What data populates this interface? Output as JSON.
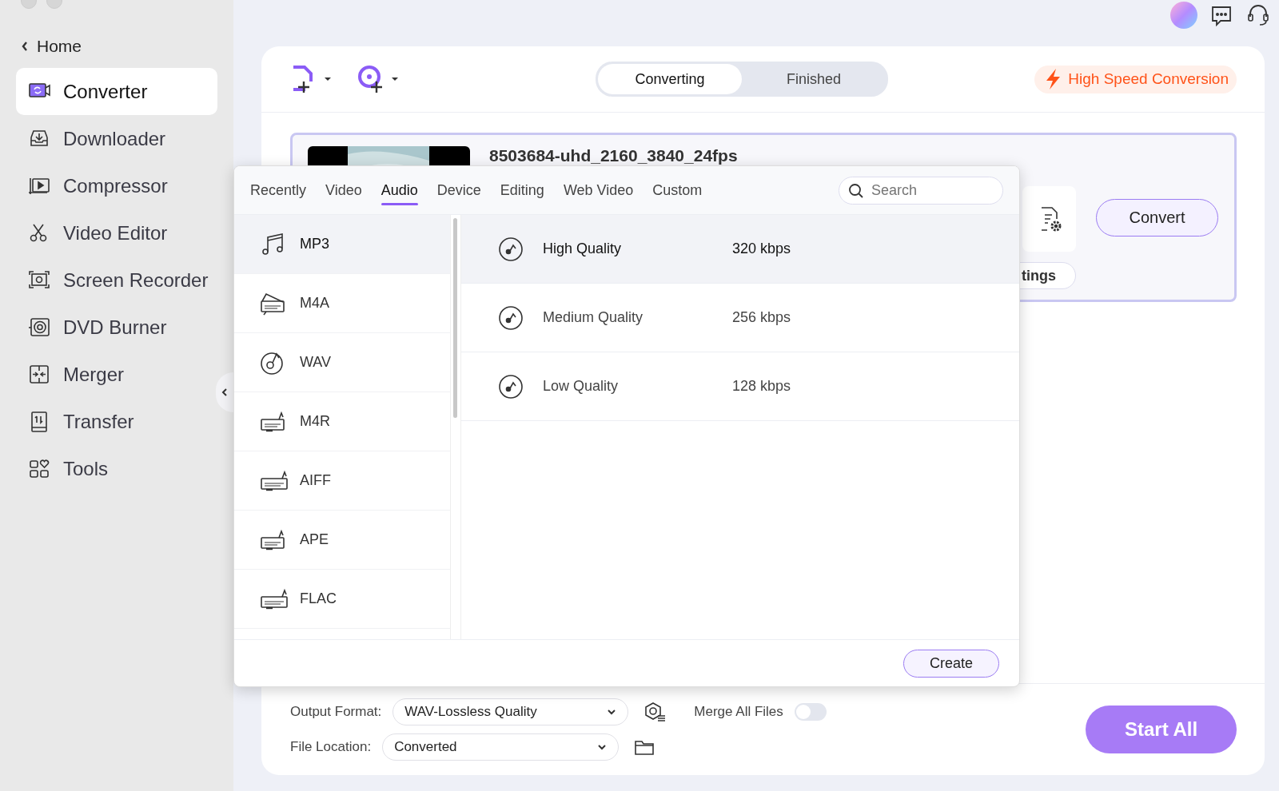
{
  "sidebar": {
    "back": "Home",
    "items": [
      {
        "label": "Converter",
        "selected": true
      },
      {
        "label": "Downloader",
        "selected": false
      },
      {
        "label": "Compressor",
        "selected": false
      },
      {
        "label": "Video Editor",
        "selected": false
      },
      {
        "label": "Screen Recorder",
        "selected": false
      },
      {
        "label": "DVD Burner",
        "selected": false
      },
      {
        "label": "Merger",
        "selected": false
      },
      {
        "label": "Transfer",
        "selected": false
      },
      {
        "label": "Tools",
        "selected": false
      }
    ]
  },
  "toolbar": {
    "segments": [
      {
        "label": "Converting",
        "selected": true
      },
      {
        "label": "Finished",
        "selected": false
      }
    ],
    "promo": "High Speed Conversion"
  },
  "file_card": {
    "name": "8503684-uhd_2160_3840_24fps",
    "settings_button": "tings",
    "convert_button": "Convert"
  },
  "format_popup": {
    "tabs": [
      {
        "label": "Recently",
        "selected": false
      },
      {
        "label": "Video",
        "selected": false
      },
      {
        "label": "Audio",
        "selected": true
      },
      {
        "label": "Device",
        "selected": false
      },
      {
        "label": "Editing",
        "selected": false
      },
      {
        "label": "Web Video",
        "selected": false
      },
      {
        "label": "Custom",
        "selected": false
      }
    ],
    "search": {
      "placeholder": "Search"
    },
    "formats": [
      {
        "label": "MP3",
        "selected": true
      },
      {
        "label": "M4A",
        "selected": false
      },
      {
        "label": "WAV",
        "selected": false
      },
      {
        "label": "M4R",
        "selected": false
      },
      {
        "label": "AIFF",
        "selected": false
      },
      {
        "label": "APE",
        "selected": false
      },
      {
        "label": "FLAC",
        "selected": false
      }
    ],
    "qualities": [
      {
        "name": "High Quality",
        "bitrate": "320 kbps",
        "selected": true
      },
      {
        "name": "Medium Quality",
        "bitrate": "256 kbps",
        "selected": false
      },
      {
        "name": "Low Quality",
        "bitrate": "128 kbps",
        "selected": false
      }
    ],
    "create_button": "Create"
  },
  "bottom_bar": {
    "output_format_label": "Output Format:",
    "output_format": "WAV-Lossless Quality",
    "merge_label": "Merge All Files",
    "merge_on": false,
    "file_location_label": "File Location:",
    "file_location": "Converted",
    "start_button": "Start All"
  }
}
